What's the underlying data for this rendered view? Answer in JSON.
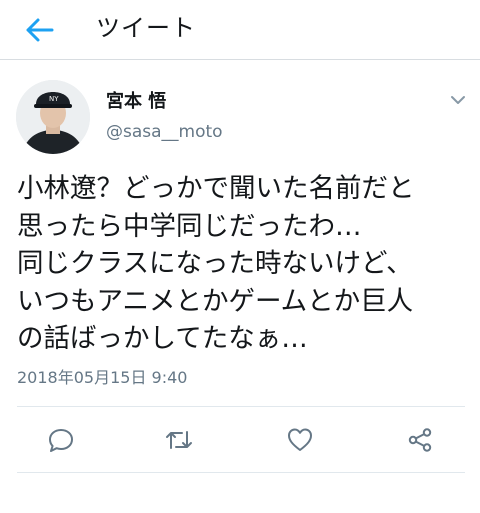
{
  "header": {
    "title": "ツイート",
    "back_icon": "arrow-left-icon",
    "accent_color": "#1da1f2"
  },
  "tweet": {
    "user": {
      "name": "宮本 悟",
      "handle": "@sasa__moto",
      "avatar_icon": "avatar-photo"
    },
    "caret_icon": "chevron-down-icon",
    "text": "小林遼？どっかで聞いた名前だと\n思ったら中学同じだったわ…\n同じクラスになった時ないけど、\nいつもアニメとかゲームとか巨人\nの話ばっかしてたなぁ…",
    "date": "2018年05月15日 9:40"
  },
  "actions": [
    {
      "name": "reply",
      "icon": "reply-icon"
    },
    {
      "name": "retweet",
      "icon": "retweet-icon"
    },
    {
      "name": "like",
      "icon": "heart-icon"
    },
    {
      "name": "share",
      "icon": "share-icon"
    }
  ],
  "colors": {
    "text": "#14171a",
    "secondary_text": "#657786",
    "icon_gray": "#657786",
    "divider": "#e1e8ed"
  }
}
